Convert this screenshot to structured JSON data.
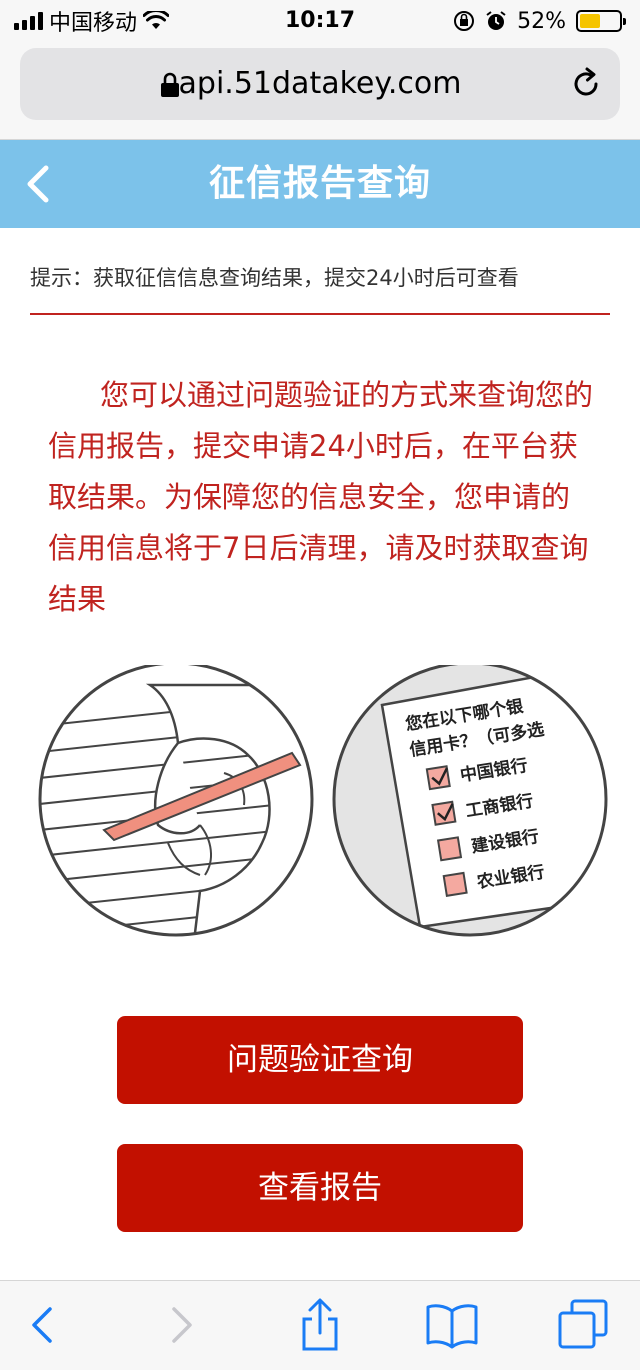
{
  "status_bar": {
    "carrier": "中国移动",
    "time": "10:17",
    "battery_percent": "52%",
    "battery_level": 0.52
  },
  "browser": {
    "url": "api.51datakey.com"
  },
  "header": {
    "title": "征信报告查询"
  },
  "tip": {
    "text": "提示：获取征信信息查询结果，提交24小时后可查看"
  },
  "intro": {
    "text": "您可以通过问题验证的方式来查询您的信用报告，提交申请24小时后，在平台获取结果。为保障您的信息安全，您申请的信用信息将于7日后清理，请及时获取查询结果"
  },
  "illustration": {
    "question_line1": "您在以下哪个银",
    "question_line2": "信用卡？（可多选",
    "options": [
      "中国银行",
      "工商银行",
      "建设银行",
      "农业银行"
    ],
    "checked": [
      true,
      true,
      false,
      false
    ]
  },
  "buttons": {
    "verify_label": "问题验证查询",
    "report_label": "查看报告"
  },
  "colors": {
    "header_bg": "#7cc2ea",
    "accent_red": "#c0231f",
    "button_red": "#c21000",
    "ios_blue": "#1a7cf5"
  }
}
